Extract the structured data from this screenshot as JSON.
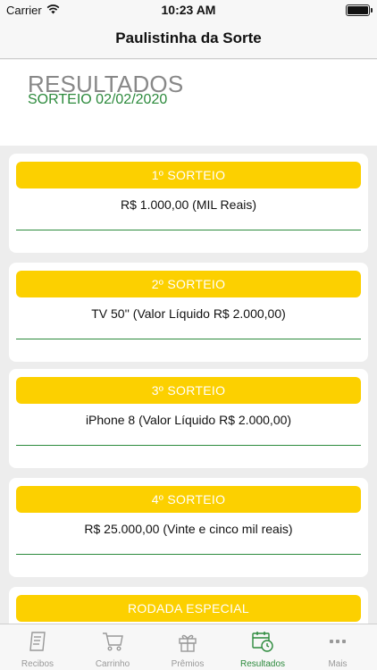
{
  "status_bar": {
    "carrier": "Carrier",
    "time": "10:23 AM"
  },
  "nav": {
    "title": "Paulistinha da Sorte"
  },
  "header": {
    "title": "RESULTADOS",
    "subtitle": "SORTEIO 02/02/2020"
  },
  "draws": [
    {
      "title": "1º SORTEIO",
      "prize": "R$ 1.000,00 (MIL Reais)"
    },
    {
      "title": "2º SORTEIO",
      "prize": "TV 50'' (Valor Líquido R$ 2.000,00)"
    },
    {
      "title": "3º SORTEIO",
      "prize": "iPhone 8 (Valor Líquido R$ 2.000,00)"
    },
    {
      "title": "4º SORTEIO",
      "prize": "R$ 25.000,00 (Vinte e cinco mil reais)"
    },
    {
      "title": "RODADA ESPECIAL",
      "prize": ""
    }
  ],
  "tabs": [
    {
      "label": "Recibos",
      "icon": "receipt-icon"
    },
    {
      "label": "Carrinho",
      "icon": "cart-icon"
    },
    {
      "label": "Prêmios",
      "icon": "gift-icon"
    },
    {
      "label": "Resultados",
      "icon": "calendar-clock-icon",
      "active": true
    },
    {
      "label": "Mais",
      "icon": "more-icon"
    }
  ],
  "colors": {
    "accent": "#fcd000",
    "green": "#2c8a3c",
    "inactive": "#999999"
  }
}
